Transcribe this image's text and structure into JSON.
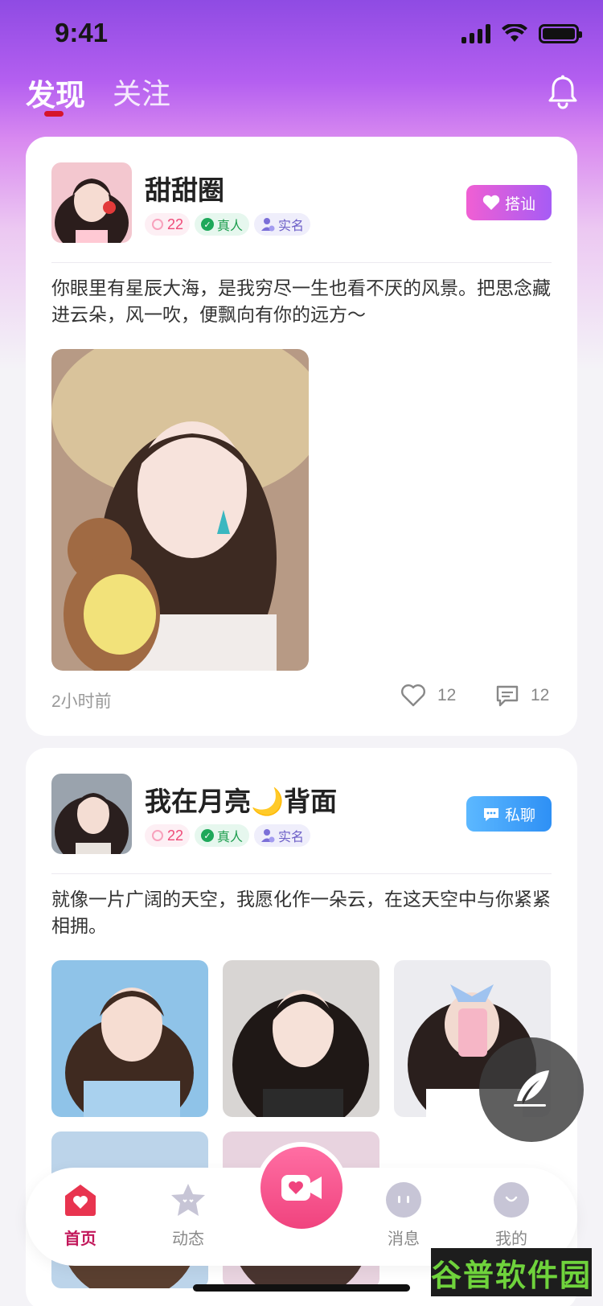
{
  "status_bar": {
    "time": "9:41"
  },
  "header": {
    "tabs": [
      {
        "label": "发现",
        "active": true
      },
      {
        "label": "关注",
        "active": false
      }
    ]
  },
  "posts": [
    {
      "nickname": "甜甜圈",
      "badges": {
        "fans_count": "22",
        "real": "真人",
        "verified_name": "实名"
      },
      "action_label": "搭讪",
      "text": "你眼里有星辰大海，是我穷尽一生也看不厌的风景。把思念藏进云朵，风一吹，便飘向有你的远方～",
      "time": "2小时前",
      "likes": "12",
      "comments": "12"
    },
    {
      "nickname": "我在月亮🌙背面",
      "badges": {
        "fans_count": "22",
        "real": "真人",
        "verified_name": "实名"
      },
      "action_label": "私聊",
      "text": "就像一片广阔的天空，我愿化作一朵云，在这天空中与你紧紧相拥。"
    }
  ],
  "bottom_nav": {
    "items": [
      {
        "label": "首页",
        "icon": "home-icon",
        "active": true
      },
      {
        "label": "动态",
        "icon": "star-face-icon",
        "active": false
      },
      {
        "label": "",
        "icon": "video-heart-icon",
        "active": false
      },
      {
        "label": "消息",
        "icon": "chat-face-icon",
        "active": false
      },
      {
        "label": "我的",
        "icon": "smile-face-icon",
        "active": false
      }
    ]
  },
  "watermark": "谷普软件园",
  "colors": {
    "accent": "#c2185b",
    "flirt_button": "#d65ee0",
    "chat_button": "#3aa0f7",
    "tab_indicator": "#d6142b"
  }
}
